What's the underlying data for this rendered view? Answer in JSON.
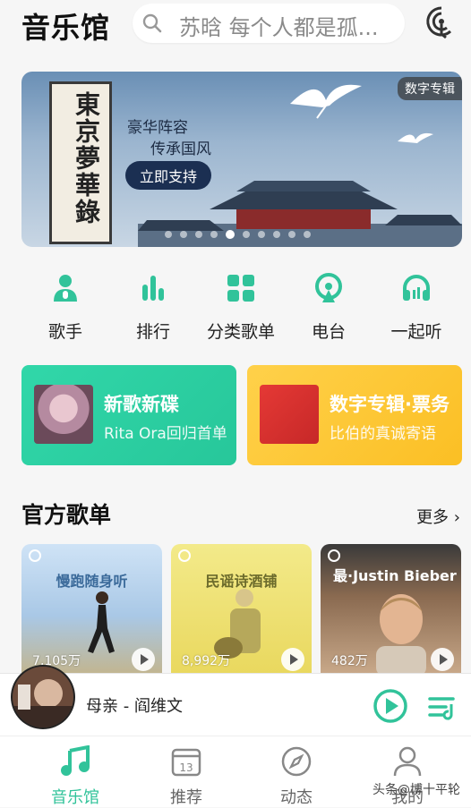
{
  "header": {
    "title": "音乐馆",
    "search_placeholder": "苏晗 每个人都是孤..."
  },
  "banner": {
    "badge": "数字专辑",
    "scroll_title": "東京夢華錄",
    "line1": "豪华阵容",
    "line2": "传承国风",
    "button": "立即支持",
    "dot_count": 10,
    "active_dot": 4
  },
  "categories": [
    {
      "label": "歌手",
      "icon": "singer-icon"
    },
    {
      "label": "排行",
      "icon": "chart-icon"
    },
    {
      "label": "分类歌单",
      "icon": "grid-icon"
    },
    {
      "label": "电台",
      "icon": "radio-icon"
    },
    {
      "label": "一起听",
      "icon": "headphone-icon"
    }
  ],
  "cards": [
    {
      "title": "新歌新碟",
      "subtitle": "Rita Ora回归首单"
    },
    {
      "title": "数字专辑·票务",
      "subtitle": "比伯的真诚寄语"
    }
  ],
  "official": {
    "title": "官方歌单",
    "more": "更多",
    "playlists": [
      {
        "name": "慢跑随身听",
        "count": "7,105万"
      },
      {
        "name": "民谣诗酒铺",
        "count": "8,992万"
      },
      {
        "name": "最·Justin Bieber",
        "count": "482万"
      }
    ]
  },
  "player": {
    "song": "母亲 - 阎维文"
  },
  "tabs": [
    {
      "label": "音乐馆",
      "active": true
    },
    {
      "label": "推荐",
      "day": "13"
    },
    {
      "label": "动态"
    },
    {
      "label": "我的"
    }
  ],
  "watermark": "头条@博十平轮",
  "colors": {
    "accent": "#31c39a",
    "card_green": "#2ecfa2",
    "card_yellow": "#fdc833"
  }
}
